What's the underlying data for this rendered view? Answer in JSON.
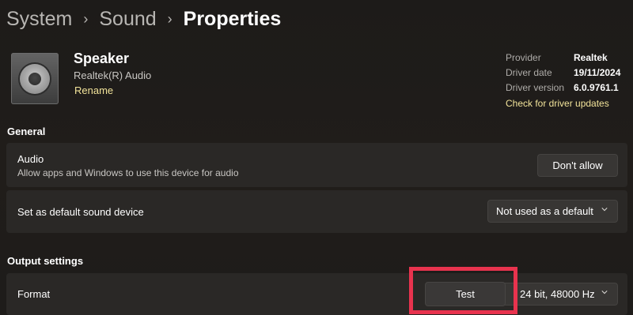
{
  "breadcrumb": {
    "items": [
      "System",
      "Sound",
      "Properties"
    ],
    "separator": "›"
  },
  "device": {
    "icon": "speaker-icon",
    "name": "Speaker",
    "subtitle": "Realtek(R) Audio",
    "rename_label": "Rename"
  },
  "driver": {
    "rows": [
      {
        "label": "Provider",
        "value": "Realtek"
      },
      {
        "label": "Driver date",
        "value": "19/11/2024"
      },
      {
        "label": "Driver version",
        "value": "6.0.9761.1"
      }
    ],
    "update_link": "Check for driver updates"
  },
  "general": {
    "heading": "General",
    "audio": {
      "label": "Audio",
      "description": "Allow apps and Windows to use this device for audio",
      "button_label": "Don't allow"
    },
    "default_device": {
      "label": "Set as default sound device",
      "selected": "Not used as a default"
    }
  },
  "output": {
    "heading": "Output settings",
    "format": {
      "label": "Format",
      "selected": "24 bit, 48000 Hz",
      "test_button_label": "Test"
    }
  },
  "colors": {
    "background": "#1e1c1a",
    "card": "#2a2826",
    "accent_link": "#f2e39a",
    "highlight": "#e8334e"
  }
}
